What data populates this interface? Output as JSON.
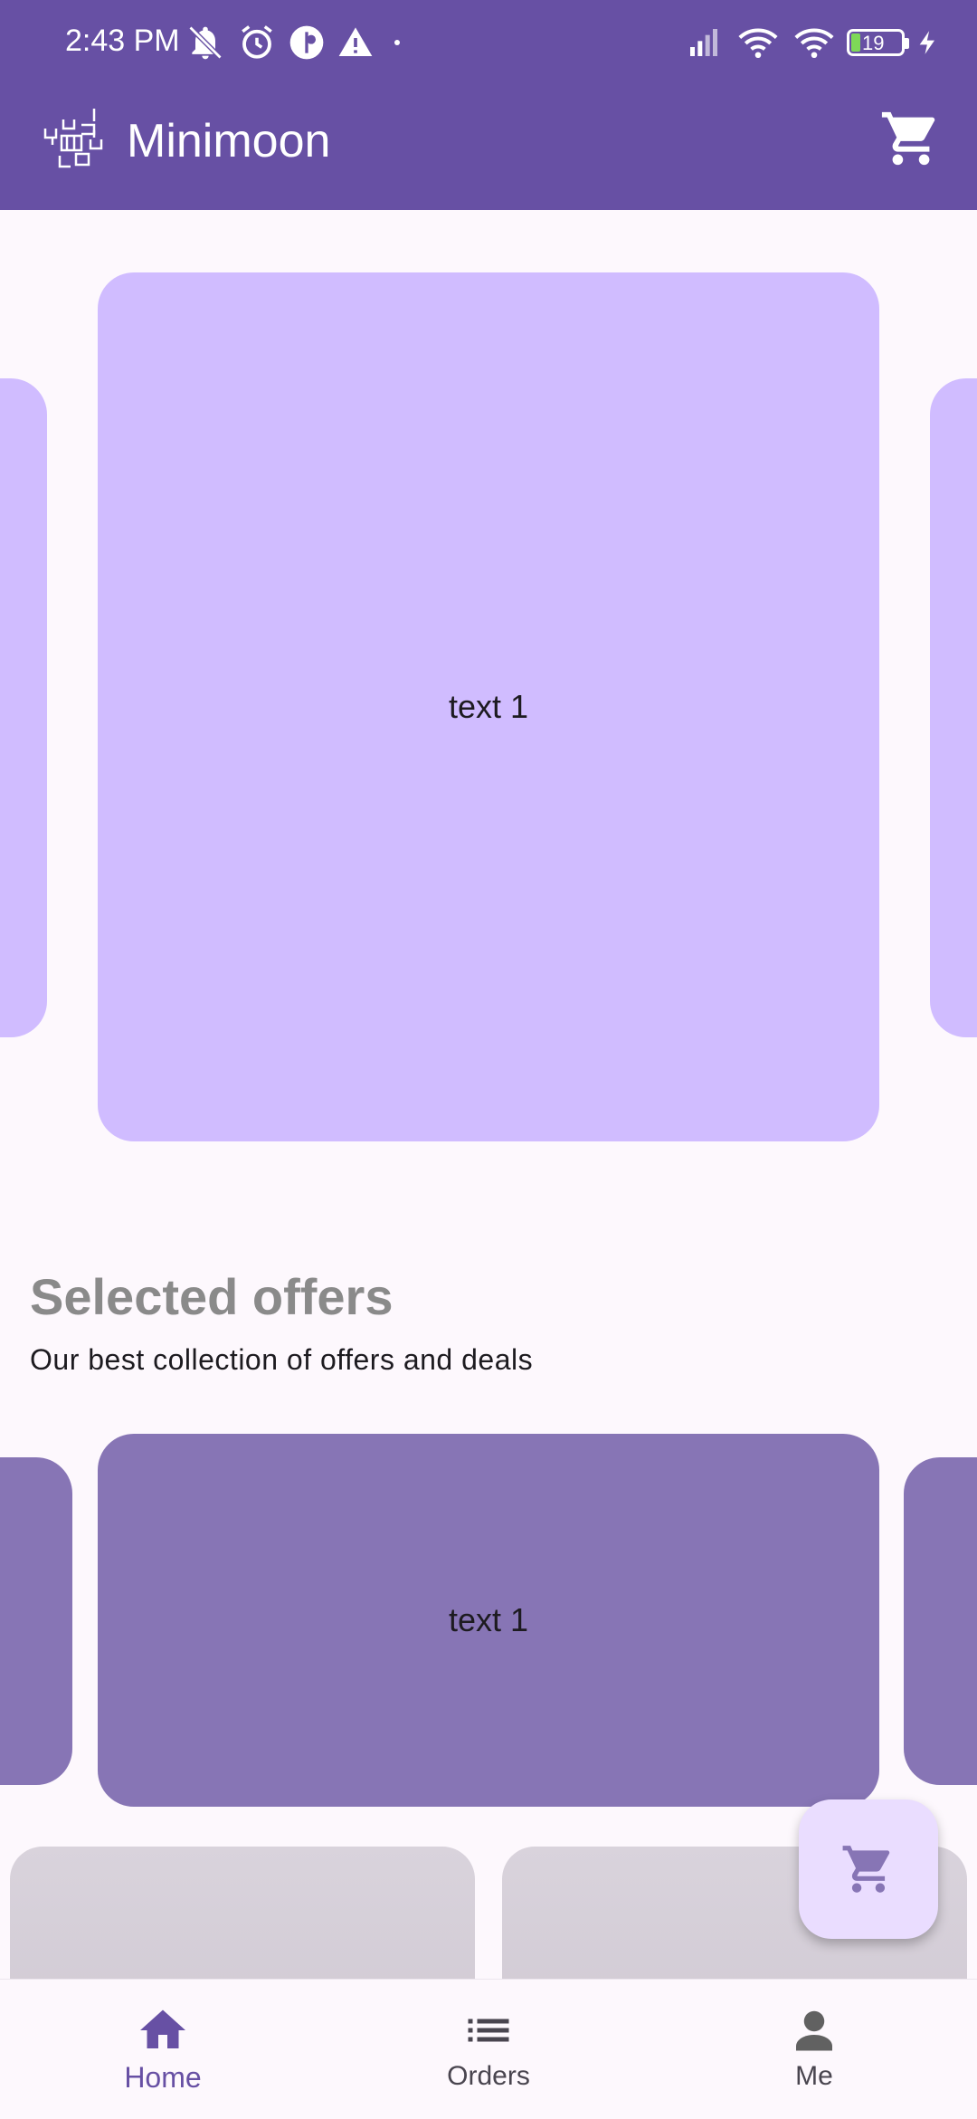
{
  "status_bar": {
    "time": "2:43 PM",
    "battery": "19"
  },
  "app_bar": {
    "title": "Minimoon"
  },
  "hero_carousel": {
    "items": [
      {
        "label": ""
      },
      {
        "label": "text 1"
      },
      {
        "label": ""
      }
    ]
  },
  "offers": {
    "title": "Selected offers",
    "subtitle": "Our best collection of offers and deals",
    "items": [
      {
        "label": ""
      },
      {
        "label": "text 1"
      },
      {
        "label": ""
      }
    ]
  },
  "bottom_nav": {
    "items": [
      {
        "label": "Home",
        "icon": "home-icon",
        "active": true
      },
      {
        "label": "Orders",
        "icon": "list-icon",
        "active": false
      },
      {
        "label": "Me",
        "icon": "person-icon",
        "active": false
      }
    ]
  },
  "colors": {
    "primary": "#6750a4",
    "hero_card": "#d0bcff",
    "offer_card": "#8775b5",
    "fab": "#eaddff"
  }
}
